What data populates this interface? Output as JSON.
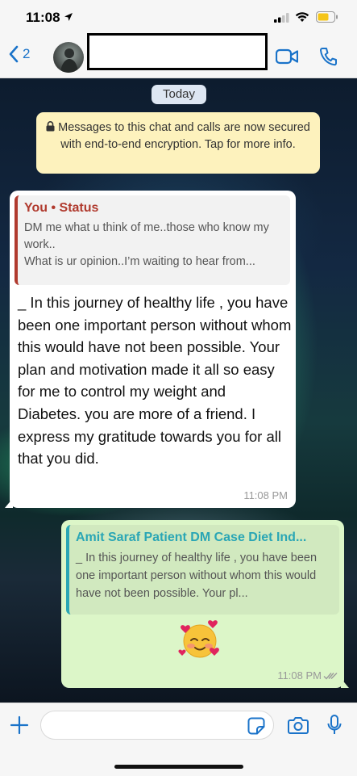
{
  "status_bar": {
    "time": "11:08",
    "icons": [
      "location-arrow-icon",
      "signal-icon",
      "wifi-icon",
      "battery-icon"
    ]
  },
  "header": {
    "back_count": "2",
    "contact_name": "",
    "icons": [
      "back-chevron-icon",
      "video-call-icon",
      "phone-icon"
    ],
    "accent_color": "#1a73c9"
  },
  "chat": {
    "date_label": "Today",
    "encryption_notice": "Messages to this chat and calls are now secured with end-to-end encryption. Tap for more info.",
    "incoming": {
      "quote_title": "You • Status",
      "quote_body": "DM me what u think of me..those who know my work..\nWhat is ur opinion..I’m waiting to hear from...",
      "text": "_ In this journey of healthy life , you have been one important person without whom this would have not been possible. Your plan and motivation made it all so easy for me to control my weight and Diabetes. you are more of a friend. I express my gratitude towards you for all that you did.",
      "time": "11:08 PM",
      "quote_color": "#b03a2e"
    },
    "outgoing": {
      "quote_title": "Amit Saraf Patient DM Case Diet Ind...",
      "quote_body": "_ In this journey of healthy life , you have been one important person without whom this would have not been possible. Your pl...",
      "emoji": "smiling-face-with-hearts-icon",
      "time": "11:08 PM",
      "quote_color": "#2aa6b5",
      "bubble_color": "#dcf6c8"
    }
  },
  "input_bar": {
    "placeholder": "",
    "icons": [
      "plus-icon",
      "sticker-icon",
      "camera-icon",
      "microphone-icon"
    ]
  }
}
